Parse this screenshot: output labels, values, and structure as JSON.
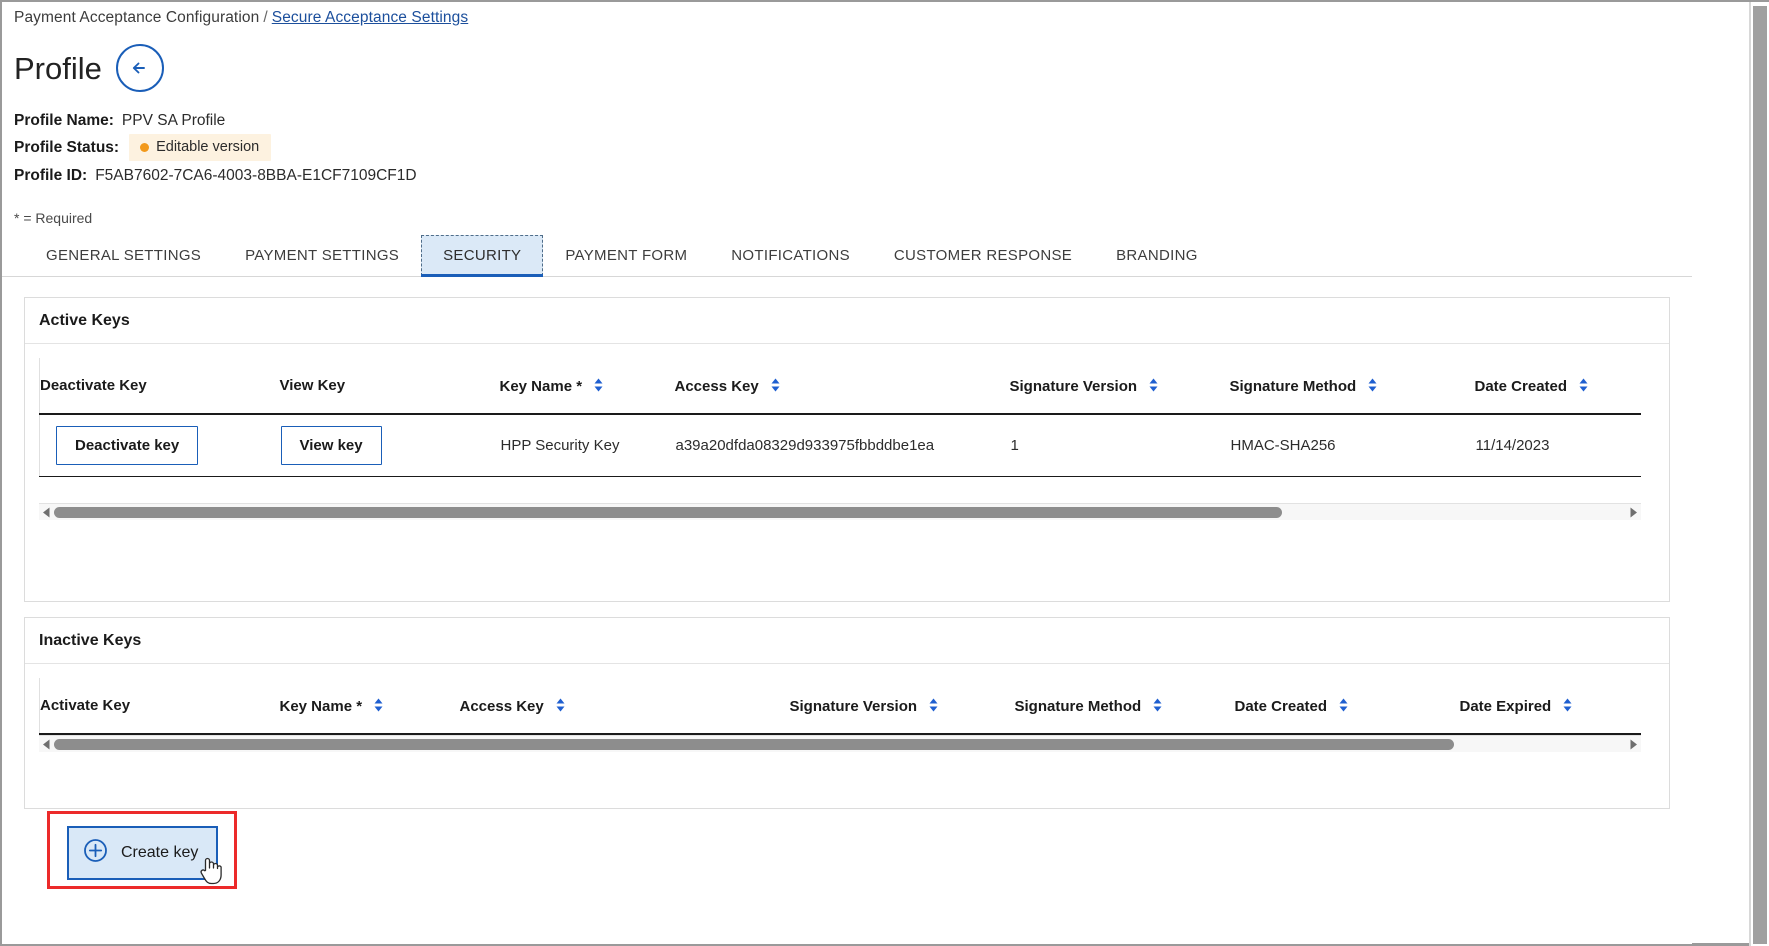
{
  "breadcrumb": {
    "root": "Payment Acceptance Configuration",
    "separator": "/",
    "current": "Secure Acceptance Settings"
  },
  "header": {
    "title": "Profile",
    "back_icon": "arrow-left-icon"
  },
  "profile": {
    "name_label": "Profile Name:",
    "name_value": "PPV SA Profile",
    "status_label": "Profile Status:",
    "status_value": "Editable version",
    "status_dot_color": "#f2991b",
    "status_bg_color": "#fdf2e0",
    "id_label": "Profile ID:",
    "id_value": "F5AB7602-7CA6-4003-8BBA-E1CF7109CF1D"
  },
  "required_note": "* = Required",
  "tabs": [
    {
      "label": "GENERAL SETTINGS",
      "active": false
    },
    {
      "label": "PAYMENT SETTINGS",
      "active": false
    },
    {
      "label": "SECURITY",
      "active": true
    },
    {
      "label": "PAYMENT FORM",
      "active": false
    },
    {
      "label": "NOTIFICATIONS",
      "active": false
    },
    {
      "label": "CUSTOMER RESPONSE",
      "active": false
    },
    {
      "label": "BRANDING",
      "active": false
    }
  ],
  "active_keys": {
    "section_title": "Active Keys",
    "columns": [
      "Deactivate Key",
      "View Key",
      "Key Name *",
      "Access Key",
      "Signature Version",
      "Signature Method",
      "Date Created"
    ],
    "rows": [
      {
        "deactivate_label": "Deactivate key",
        "view_label": "View key",
        "key_name": "HPP Security Key",
        "access_key": "a39a20dfda08329d933975fbbddbe1ea",
        "signature_version": "1",
        "signature_method": "HMAC-SHA256",
        "date_created": "11/14/2023"
      }
    ],
    "create_button": "Create key",
    "create_icon": "plus-circle-icon"
  },
  "inactive_keys": {
    "section_title": "Inactive Keys",
    "columns": [
      "Activate Key",
      "Key Name *",
      "Access Key",
      "Signature Version",
      "Signature Method",
      "Date Created",
      "Date Expired"
    ],
    "rows": []
  },
  "colors": {
    "link": "#1c4f9c",
    "accent": "#1a5eb8",
    "tab_active_bg": "#dbe9f7",
    "annotation": "#ec2a2a",
    "sort_arrow": "#1f5fd0"
  }
}
